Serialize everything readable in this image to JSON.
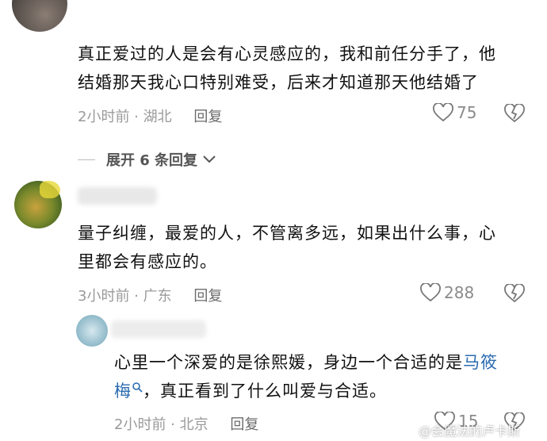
{
  "comments": [
    {
      "text": "真正爱过的人是会有心灵感应的，我和前任分手了，他结婚那天我心口特别难受，后来才知道那天他结婚了",
      "line1": "真正爱过的人是会有心灵感应的，我和前任分手了，他",
      "line2": "结婚那天我心口特别难受，后来才知道那天他结婚了",
      "meta": "2小时前 · 湖北",
      "reply_label": "回复",
      "likes": "75"
    },
    {
      "line1": "量子纠缠，最爱的人，不管离多远，如果出什么事，心",
      "line2": "里都会有感应的。",
      "meta": "3小时前 · 广东",
      "reply_label": "回复",
      "likes": "288"
    }
  ],
  "expand_replies": "展开 6 条回复",
  "reply": {
    "line1_before": "心里一个深爱的是徐熙媛，身边一个合适的是",
    "link_text_a": "马筱",
    "link_text_b": "梅",
    "line2_after": "，真正看到了什么叫爱与合适。",
    "meta": "2小时前 · 北京",
    "reply_label": "回复",
    "likes": "15"
  },
  "watermark": "@会魔法的卢卡斯",
  "icons": [
    "heart-icon",
    "broken-heart-icon",
    "chevron-down-icon",
    "search-icon"
  ],
  "colors": {
    "link": "#2b6cb0",
    "meta": "#9a9a9a",
    "text": "#111111"
  }
}
